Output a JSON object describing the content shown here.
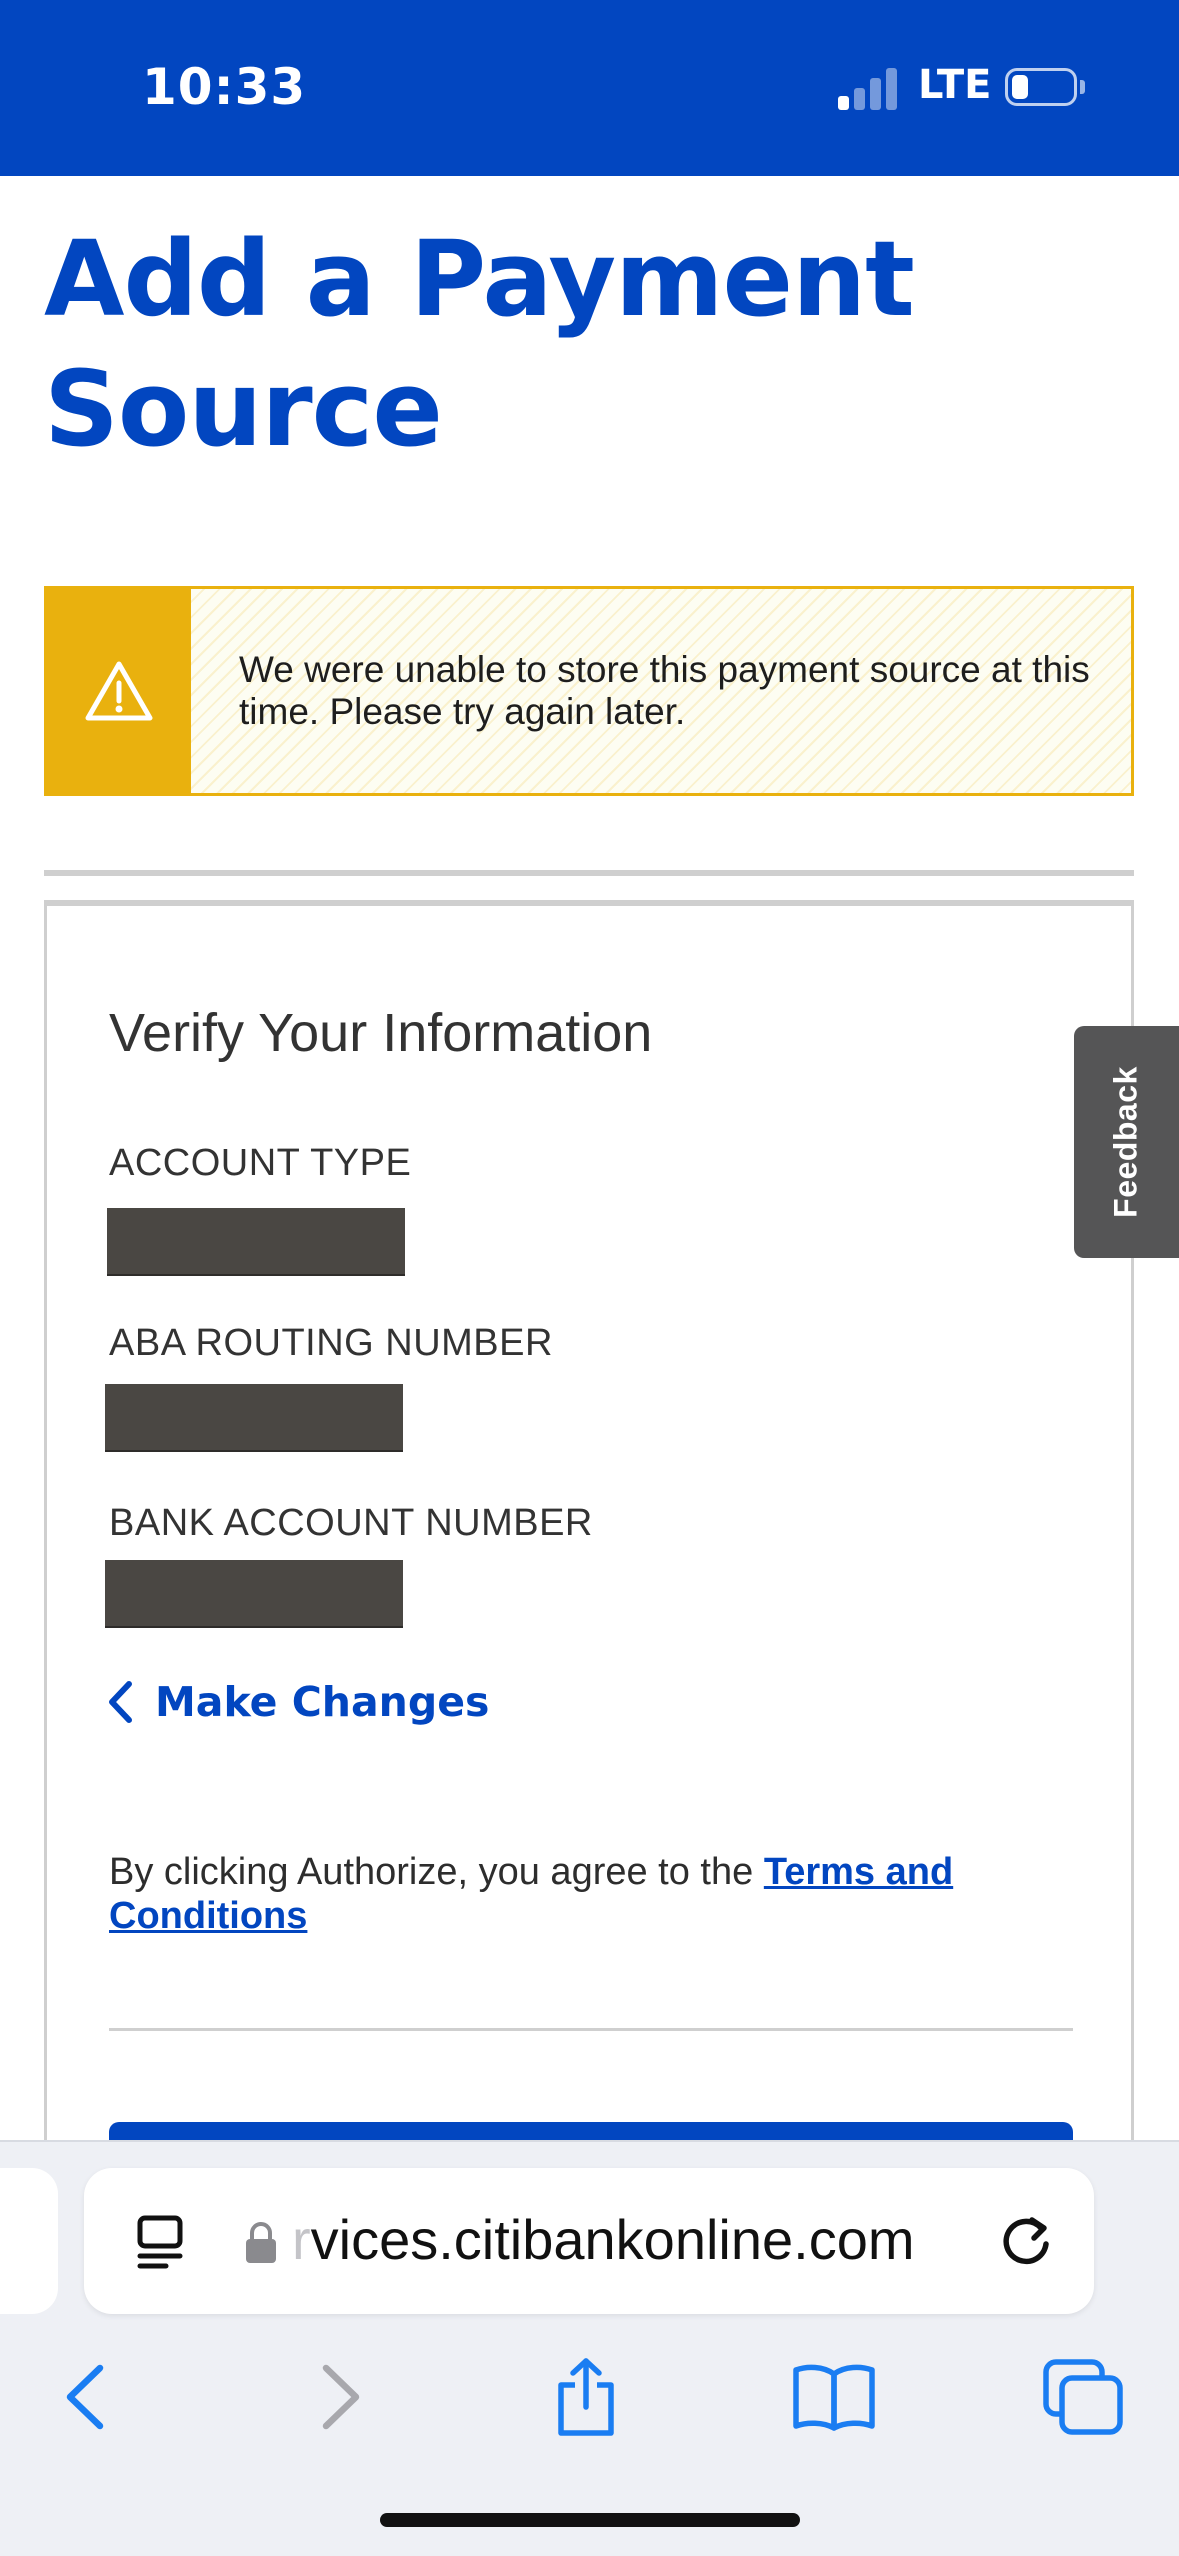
{
  "status_bar": {
    "time": "10:33",
    "network": "LTE",
    "battery_level": 0.15
  },
  "page": {
    "title": "Add a Payment Source"
  },
  "alert": {
    "icon": "warning-icon",
    "message": "We were unable to store this payment source at this time. Please try again later.",
    "accent_color": "#e9b10e"
  },
  "verify": {
    "title": "Verify Your Information",
    "fields": [
      {
        "label": "ACCOUNT TYPE"
      },
      {
        "label": "ABA ROUTING NUMBER"
      },
      {
        "label": "BANK ACCOUNT NUMBER"
      }
    ],
    "make_changes_label": "Make Changes",
    "terms_prefix": "By clicking Authorize, you agree to the ",
    "terms_link": "Terms and Conditions"
  },
  "feedback": {
    "label": "Feedback"
  },
  "browser": {
    "url": "vices.citibankonline.com",
    "url_prefix_faded": "r"
  },
  "colors": {
    "brand_blue": "#0246c0",
    "redaction": "#4a4743",
    "ios_blue": "#1a7df2"
  }
}
